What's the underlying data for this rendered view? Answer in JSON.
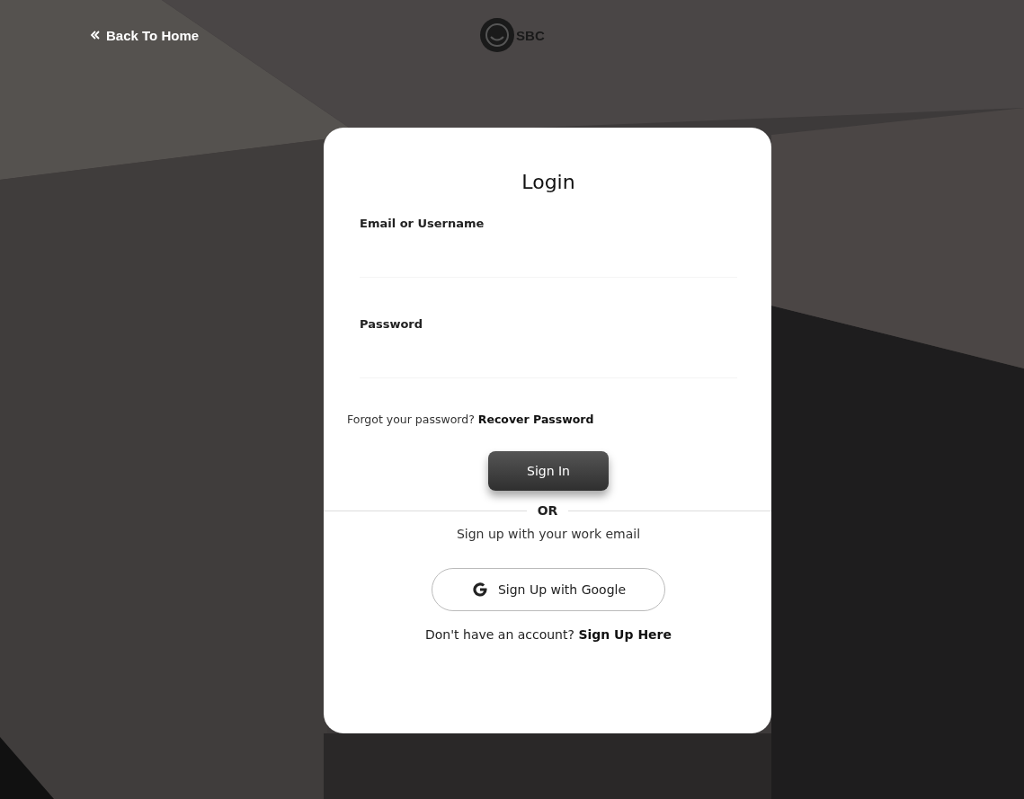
{
  "header": {
    "back_link": "Back To Home",
    "logo_text": "SBC"
  },
  "login": {
    "title": "Login",
    "fields": [
      {
        "label": "Email or Username"
      },
      {
        "label": "Password"
      }
    ],
    "forgot_text": "Forgot your password?",
    "recover_link": "Recover Password",
    "sign_in_button": "Sign In",
    "divider_text": "OR",
    "signup_hint": "Sign up with your work email",
    "google_button": "Sign Up with Google",
    "no_account_text": "Don't have an account?",
    "signup_link": "Sign Up Here"
  }
}
